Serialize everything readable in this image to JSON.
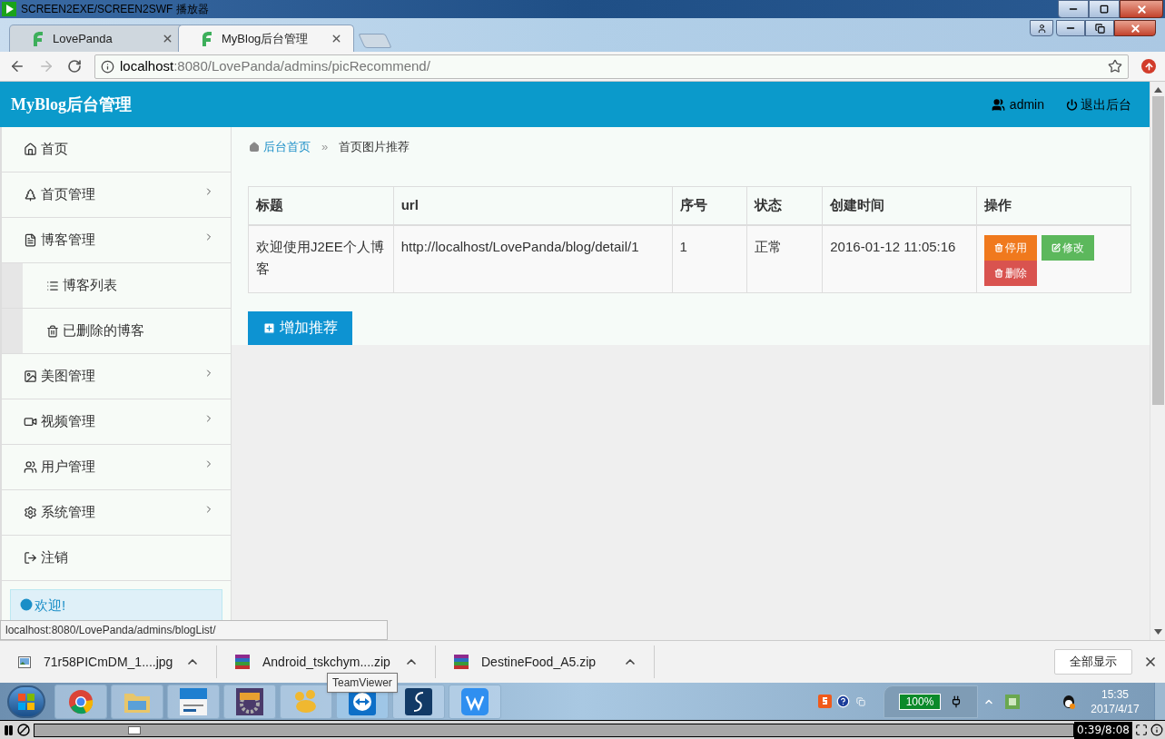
{
  "player": {
    "title": "SCREEN2EXE/SCREEN2SWF 播放器",
    "time": "0:39/8:08",
    "level": 0.09
  },
  "browser": {
    "tabs": [
      {
        "label": "LovePanda",
        "selected": false
      },
      {
        "label": "MyBlog后台管理",
        "selected": true
      }
    ],
    "url_host": "localhost",
    "url_rest": ":8080/LovePanda/admins/picRecommend/"
  },
  "header": {
    "brand": "MyBlog后台管理",
    "user": "admin",
    "logout": "退出后台"
  },
  "sidebar": {
    "items": [
      {
        "label": "首页",
        "has_submenu": false
      },
      {
        "label": "首页管理",
        "has_submenu": true
      },
      {
        "label": "博客管理",
        "has_submenu": true,
        "children": [
          {
            "label": "博客列表"
          },
          {
            "label": "已删除的博客"
          }
        ]
      },
      {
        "label": "美图管理",
        "has_submenu": true
      },
      {
        "label": "视频管理",
        "has_submenu": true
      },
      {
        "label": "用户管理",
        "has_submenu": true
      },
      {
        "label": "系统管理",
        "has_submenu": true
      },
      {
        "label": "注销",
        "has_submenu": false
      }
    ],
    "welcome": "欢迎!"
  },
  "breadcrumb": {
    "home": "后台首页",
    "separator": "»",
    "current": "首页图片推荐"
  },
  "table": {
    "columns": [
      "标题",
      "url",
      "序号",
      "状态",
      "创建时间",
      "操作"
    ],
    "rows": [
      {
        "cells": [
          "欢迎使用J2EE个人博客",
          "http://localhost/LovePanda/blog/detail/1",
          "1",
          "正常",
          "2016-01-12 11:05:16"
        ],
        "actions": [
          {
            "label": "停用",
            "kind": "disable"
          },
          {
            "label": "修改",
            "kind": "edit"
          },
          {
            "label": "删除",
            "kind": "delete"
          }
        ]
      }
    ]
  },
  "add_button": "增加推荐",
  "status_url": "localhost:8080/LovePanda/admins/blogList/",
  "downloads": {
    "items": [
      {
        "name": "71r58PICmDM_1....jpg",
        "kind": "image"
      },
      {
        "name": "Android_tskchym....zip",
        "kind": "archive"
      },
      {
        "name": "DestineFood_A5.zip",
        "kind": "archive"
      }
    ],
    "show_all": "全部显示"
  },
  "taskbar": {
    "tooltip": "TeamViewer",
    "battery": "100%",
    "time": "15:35",
    "date": "2017/4/17"
  }
}
